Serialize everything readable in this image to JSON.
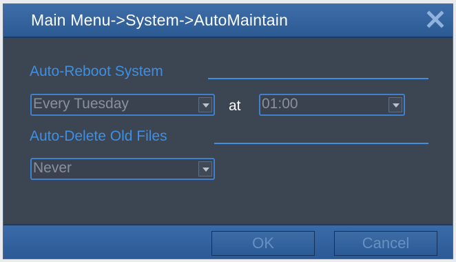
{
  "window": {
    "title": "Main Menu->System->AutoMaintain",
    "close_icon": "close-x-icon"
  },
  "auto_reboot": {
    "label": "Auto-Reboot System",
    "day_value": "Every Tuesday",
    "at_label": "at",
    "time_value": "01:00"
  },
  "auto_delete": {
    "label": "Auto-Delete Old Files",
    "value": "Never"
  },
  "footer": {
    "ok_label": "OK",
    "cancel_label": "Cancel"
  },
  "colors": {
    "title_bar": "#2c5a93",
    "panel": "#3c4552",
    "accent": "#3f8fe2"
  }
}
